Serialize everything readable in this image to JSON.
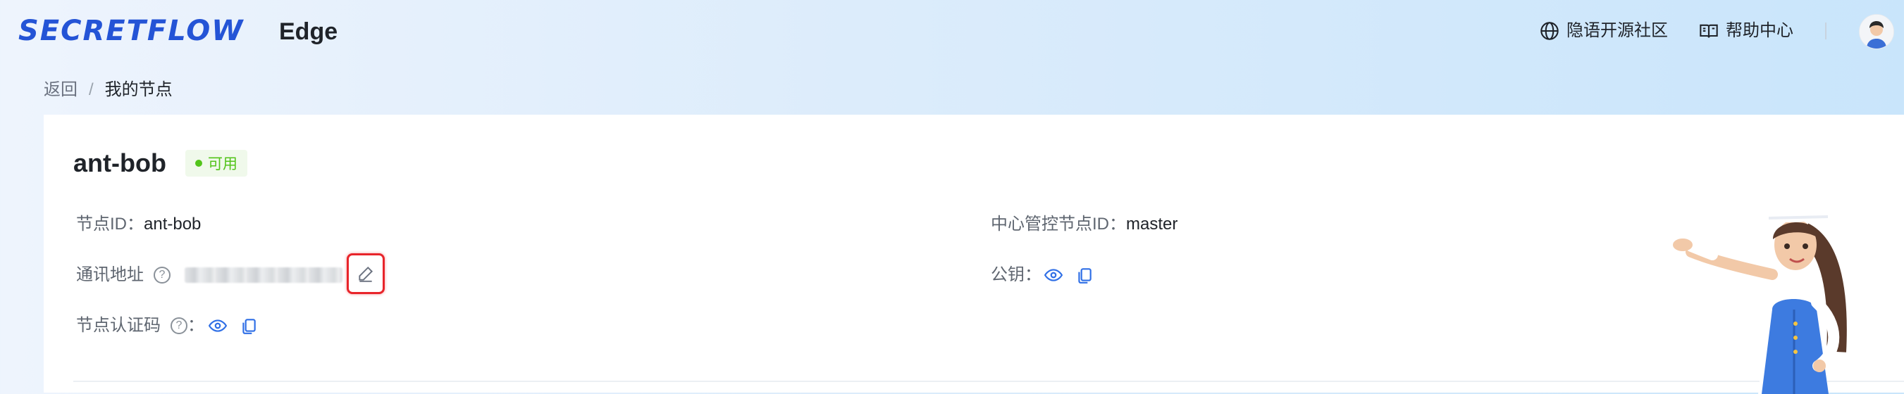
{
  "header": {
    "logo_text": "SECRETFLOW",
    "product_name": "Edge",
    "community_link": "隐语开源社区",
    "help_link": "帮助中心",
    "brand_color": "#2454d6"
  },
  "breadcrumb": {
    "back": "返回",
    "separator": "/",
    "current": "我的节点"
  },
  "node": {
    "name": "ant-bob",
    "status": "可用",
    "status_color": "#52c41a",
    "node_id_label": "节点ID：",
    "node_id_value": "ant-bob",
    "address_label": "通讯地址",
    "auth_code_label": "节点认证码",
    "auth_code_colon": "：",
    "master_id_label": "中心管控节点ID：",
    "master_id_value": "master",
    "public_key_label": "公钥："
  },
  "icons": {
    "community": "globe-icon",
    "help": "book-icon",
    "edit": "edit-pencil-icon",
    "view": "eye-icon",
    "copy": "copy-icon",
    "help_hint": "question-circle-icon"
  }
}
